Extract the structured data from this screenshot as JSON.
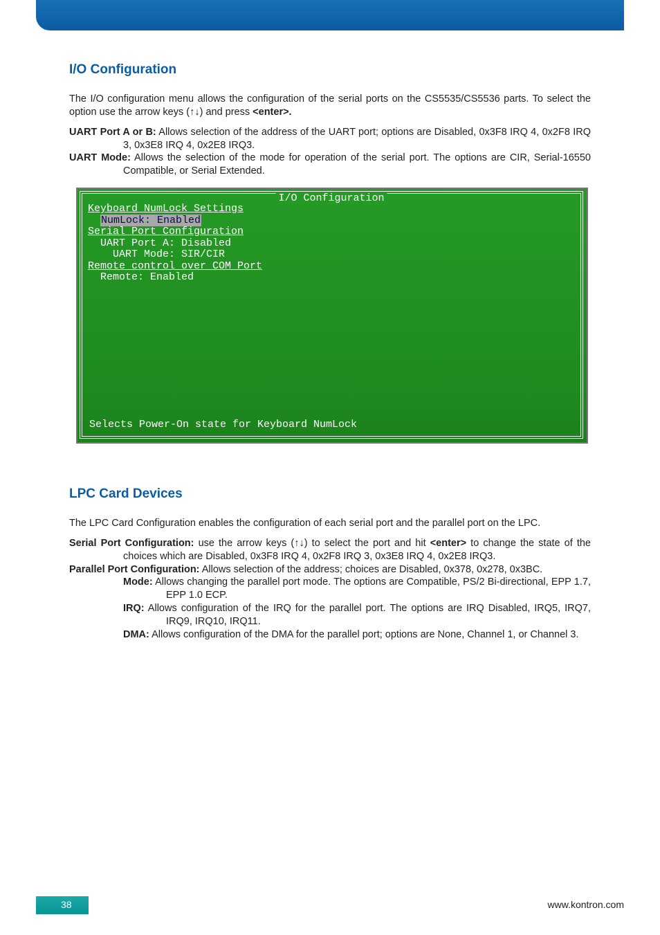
{
  "header_bar": "",
  "section1": {
    "title": "I/O Configuration",
    "intro": "The I/O configuration menu allows the configuration of the serial ports on the CS5535/CS5536 parts. To select the option use the arrow keys (↑↓) and press ",
    "intro_bold": "<enter>.",
    "uart_port_label": "UART Port A or B:",
    "uart_port_text": " Allows selection of the address of the UART port; options are Disabled, 0x3F8 IRQ 4, 0x2F8 IRQ 3, 0x3E8 IRQ 4, 0x2E8 IRQ3.",
    "uart_mode_label": "UART Mode:",
    "uart_mode_text": " Allows the selection of the mode for operation of the serial port. The options are CIR, Serial-16550 Compatible, or Serial Extended."
  },
  "bios": {
    "title": " I/O Configuration ",
    "l1": "Keyboard NumLock Settings",
    "l2_pre": "  ",
    "l2_sel": "NumLock: Enabled",
    "blank": "",
    "l3": "Serial Port Configuration",
    "l4": "  UART Port A: Disabled",
    "l5": "    UART Mode: SIR/CIR",
    "l6": "Remote control over COM Port",
    "l7": "  Remote: Enabled",
    "footer": "Selects Power-On state for Keyboard NumLock"
  },
  "section2": {
    "title": "LPC Card Devices",
    "intro": "The LPC Card Configuration enables the configuration of each serial port and the parallel port on the LPC.",
    "sp_label": "Serial Port Configuration:",
    "sp_text_a": " use the arrow keys (↑↓) to select the port and hit ",
    "sp_bold": "<enter>",
    "sp_text_b": " to change the state of the choices which are Disabled, 0x3F8 IRQ 4, 0x2F8 IRQ 3, 0x3E8 IRQ 4, 0x2E8 IRQ3.",
    "pp_label": "Parallel Port Configuration:",
    "pp_text": " Allows selection of the address; choices are Disabled, 0x378, 0x278, 0x3BC.",
    "mode_label": "Mode:",
    "mode_text": " Allows changing the parallel port mode. The options are Compatible, PS/2 Bi-directional, EPP 1.7, EPP 1.0 ECP.",
    "irq_label": "IRQ:",
    "irq_text": " Allows configuration of the IRQ for the parallel port. The options are IRQ Disabled, IRQ5, IRQ7, IRQ9, IRQ10, IRQ11.",
    "dma_label": "DMA:",
    "dma_text": " Allows configuration of the DMA for the parallel port; options are None, Channel 1, or Channel 3."
  },
  "footer": {
    "page": "38",
    "url": "www.kontron.com"
  }
}
